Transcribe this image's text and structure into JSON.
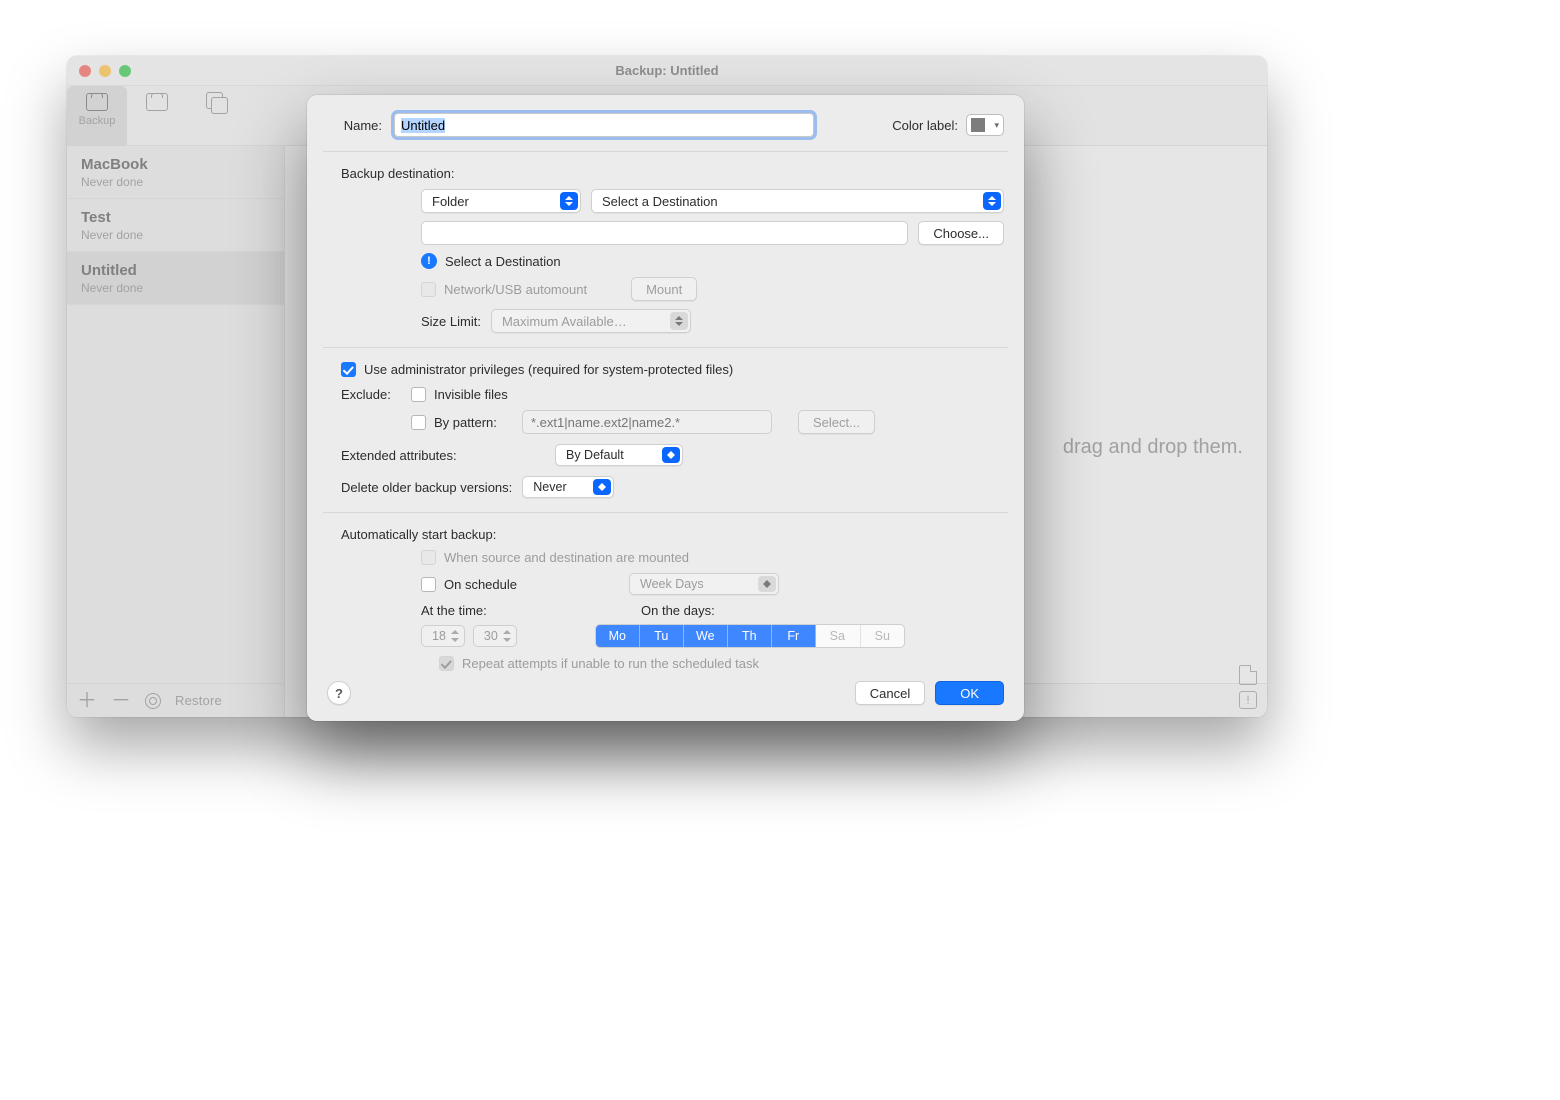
{
  "window": {
    "title": "Backup: Untitled",
    "tabs": {
      "backup": "Backup"
    },
    "main_hint": "drag and drop them.",
    "bottom": {
      "restore": "Restore"
    }
  },
  "sidebar": {
    "items": [
      {
        "name": "MacBook",
        "sub": "Never done"
      },
      {
        "name": "Test",
        "sub": "Never done"
      },
      {
        "name": "Untitled",
        "sub": "Never done"
      }
    ]
  },
  "sheet": {
    "name_label": "Name:",
    "name_value": "Untitled",
    "color_label": "Color label:",
    "dest_title": "Backup destination:",
    "dest_type": "Folder",
    "dest_select": "Select a Destination",
    "dest_path": "",
    "choose": "Choose...",
    "dest_warn": "Select a Destination",
    "automount": "Network/USB automount",
    "mount": "Mount",
    "size_limit_label": "Size Limit:",
    "size_limit_value": "Maximum Available…",
    "admin": "Use administrator privileges (required for system-protected files)",
    "exclude_label": "Exclude:",
    "exclude_invisible": "Invisible files",
    "exclude_pattern_label": "By pattern:",
    "exclude_pattern_placeholder": "*.ext1|name.ext2|name2.*",
    "select_btn": "Select...",
    "ext_attr_label": "Extended attributes:",
    "ext_attr_value": "By Default",
    "delete_label": "Delete older backup versions:",
    "delete_value": "Never",
    "auto_title": "Automatically start backup:",
    "when_mounted": "When source and destination are mounted",
    "on_schedule": "On schedule",
    "schedule_mode": "Week Days",
    "at_time_label": "At the time:",
    "hour": "18",
    "minute": "30",
    "on_days_label": "On the days:",
    "days": [
      "Mo",
      "Tu",
      "We",
      "Th",
      "Fr",
      "Sa",
      "Su"
    ],
    "days_on": [
      true,
      true,
      true,
      true,
      true,
      false,
      false
    ],
    "repeat": "Repeat attempts if unable to run the scheduled task",
    "cancel": "Cancel",
    "ok": "OK"
  }
}
